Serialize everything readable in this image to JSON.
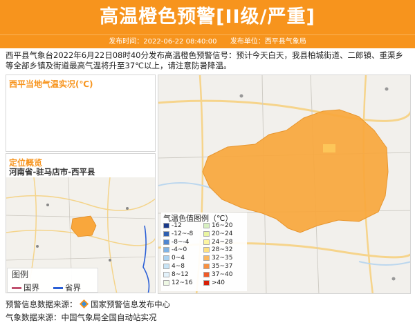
{
  "header": {
    "title": "高温橙色预警[II级/严重]",
    "publish_time_label": "发布时间：2022-06-22 08:40:00",
    "publish_unit_label": "发布单位：西平县气象局"
  },
  "description": "西平县气象台2022年6月22日08时40分发布高温橙色预警信号：预计今天白天，我县柏城街道、二郎镇、重渠乡等全部乡镇及街道最高气温将升至37℃以上，请注意防暑降温。",
  "panels": {
    "temp_title": "西平当地气温实况(℃)",
    "location_title": "定位概览",
    "location_path": "河南省-驻马店市-西平县"
  },
  "location_legend": {
    "title": "图例",
    "national_border": "国界",
    "provincial_border": "省界"
  },
  "colors": {
    "accent": "#f7941d",
    "warning_area": "#f9a73c",
    "national_border": "#c0506e",
    "provincial_border": "#2a5fd6"
  },
  "temp_legend": {
    "title": "气温色值图例（℃）",
    "items": [
      {
        "label": "-12",
        "color": "#1a3a8a"
      },
      {
        "label": "16~20",
        "color": "#d8f0c0"
      },
      {
        "label": "-12~-8",
        "color": "#2f5fb0"
      },
      {
        "label": "20~24",
        "color": "#eaf5a0"
      },
      {
        "label": "-8~-4",
        "color": "#4f86d1"
      },
      {
        "label": "24~28",
        "color": "#fdf5a0"
      },
      {
        "label": "-4~0",
        "color": "#7fb3e6"
      },
      {
        "label": "28~32",
        "color": "#fde080"
      },
      {
        "label": "0~4",
        "color": "#a9d2f2"
      },
      {
        "label": "32~35",
        "color": "#fbb860"
      },
      {
        "label": "4~8",
        "color": "#c8e4f6"
      },
      {
        "label": "35~37",
        "color": "#f89040"
      },
      {
        "label": "8~12",
        "color": "#e3f2fb"
      },
      {
        "label": "37~40",
        "color": "#f05a28"
      },
      {
        "label": "12~16",
        "color": "#eef8e4"
      },
      {
        "label": ">40",
        "color": "#d81e06"
      }
    ]
  },
  "footer": {
    "warning_source": "预警信息数据来源：",
    "warning_source_name": "国家预警信息发布中心",
    "weather_source": "气象数据来源：中国气象局全国自动站实况"
  },
  "icons": {
    "cma_logo": "cma-logo-icon"
  }
}
